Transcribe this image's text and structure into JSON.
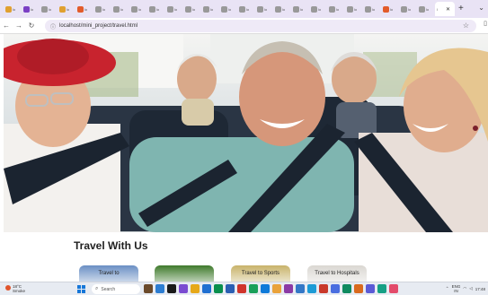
{
  "browser": {
    "tabs": [
      {
        "title": "lo",
        "color": "#e0a030"
      },
      {
        "title": "lo",
        "color": "#7b3fc4"
      },
      {
        "title": "lo",
        "color": "#999999"
      },
      {
        "title": "lo",
        "color": "#e0a030"
      },
      {
        "title": "lo",
        "color": "#e25b2a"
      },
      {
        "title": "lo",
        "color": "#999999"
      },
      {
        "title": "lo",
        "color": "#999999"
      },
      {
        "title": "lo",
        "color": "#999999"
      },
      {
        "title": "lo",
        "color": "#999999"
      },
      {
        "title": "lo",
        "color": "#999999"
      },
      {
        "title": "lo",
        "color": "#999999"
      },
      {
        "title": "lo",
        "color": "#999999"
      },
      {
        "title": "lo",
        "color": "#999999"
      },
      {
        "title": "lo",
        "color": "#999999"
      },
      {
        "title": "lo",
        "color": "#999999"
      },
      {
        "title": "lo",
        "color": "#999999"
      },
      {
        "title": "lo",
        "color": "#999999"
      },
      {
        "title": "lo",
        "color": "#999999"
      },
      {
        "title": "lo",
        "color": "#999999"
      },
      {
        "title": "lo",
        "color": "#999999"
      },
      {
        "title": "lo",
        "color": "#999999"
      },
      {
        "title": "lo",
        "color": "#e25b2a"
      },
      {
        "title": "lo",
        "color": "#999999"
      },
      {
        "title": "lo",
        "color": "#999999"
      }
    ],
    "active_tab_title": "l",
    "new_tab": "+",
    "url": "localhost/mini_project/travel.html"
  },
  "page": {
    "section_title": "Travel With Us",
    "cards": [
      {
        "label": "Travel to",
        "color": "#6a8fc4"
      },
      {
        "label": "",
        "color": "#3f7a2c"
      },
      {
        "label": "Travel to Sports",
        "color": "#c8b36a"
      },
      {
        "label": "Travel to Hospitals",
        "color": "#dad7d2"
      }
    ]
  },
  "taskbar": {
    "weather_temp": "18°C",
    "weather_desc": "Smoke",
    "search_placeholder": "Search",
    "lang": "ENG",
    "region": "IN",
    "time": "17:48",
    "date": "",
    "app_colors": [
      "#6b4a2b",
      "#2d7dd2",
      "#1a1a1a",
      "#7a4bd1",
      "#e6a819",
      "#1f6fd1",
      "#0a8f4d",
      "#2b5fb3",
      "#d0342c",
      "#19a05a",
      "#0e7ad9",
      "#e9a23b",
      "#8b3aa5",
      "#3478c7",
      "#1d9bd6",
      "#c9392b",
      "#4a6ee0",
      "#0f8a5f",
      "#d96a1e",
      "#5b5bd6",
      "#16a085",
      "#e34b6b"
    ]
  }
}
